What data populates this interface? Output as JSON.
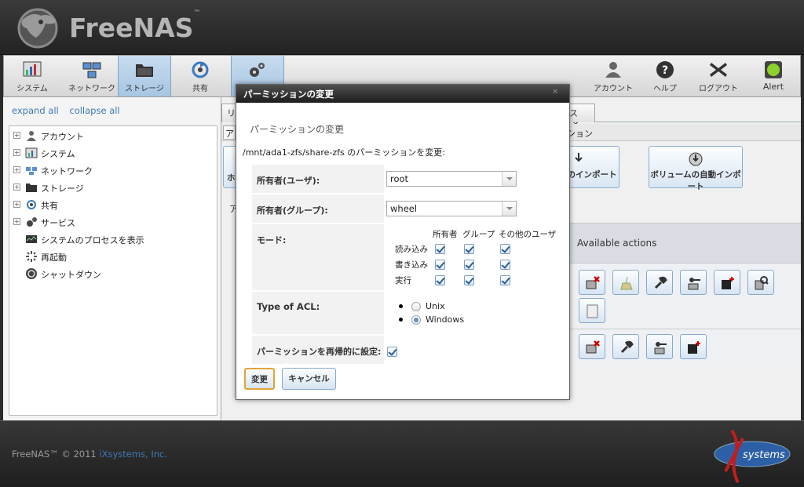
{
  "app": {
    "name": "FreeNAS",
    "tm": "™"
  },
  "toolbar": {
    "items": [
      {
        "label": "システム",
        "icon": "system-icon"
      },
      {
        "label": "ネットワーク",
        "icon": "network-icon"
      },
      {
        "label": "ストレージ",
        "icon": "storage-icon"
      },
      {
        "label": "共有",
        "icon": "sharing-icon"
      },
      {
        "label": "サービス",
        "icon": "services-icon"
      }
    ],
    "right": [
      {
        "label": "アカウント",
        "icon": "account-icon"
      },
      {
        "label": "ヘルプ",
        "icon": "help-icon"
      },
      {
        "label": "ログアウト",
        "icon": "logout-icon"
      },
      {
        "label": "Alert",
        "icon": "alert-icon"
      }
    ]
  },
  "sidebar": {
    "expand_all": "expand all",
    "collapse_all": "collapse all",
    "tree": [
      {
        "label": "アカウント"
      },
      {
        "label": "システム"
      },
      {
        "label": "ネットワーク"
      },
      {
        "label": "ストレージ"
      },
      {
        "label": "共有"
      },
      {
        "label": "サービス"
      }
    ],
    "actions": [
      {
        "label": "システムのプロセスを表示"
      },
      {
        "label": "再起動"
      },
      {
        "label": "シャットダウン"
      }
    ]
  },
  "main": {
    "tab_partial_left": "リ",
    "tab_partial_right": "ス",
    "tab_close": "✕",
    "subtab_left": "ア",
    "subtab_right": "ション",
    "left_btn_partial": "ホ",
    "auto_import_partial": "のインポート",
    "volume_auto_import": "ボリュームの自動インポート",
    "row_letter": "ア",
    "available_actions": "Available actions"
  },
  "modal": {
    "title": "パーミッションの変更",
    "heading": "パーミッションの変更",
    "path_text": "/mnt/ada1-zfs/share-zfs のパーミッションを変更:",
    "owner_user_label": "所有者(ユーザ):",
    "owner_user_value": "root",
    "owner_group_label": "所有者(グループ):",
    "owner_group_value": "wheel",
    "mode_label": "モード:",
    "mode_cols": [
      "所有者",
      "グループ",
      "その他のユーザ"
    ],
    "mode_rows": [
      "読み込み",
      "書き込み",
      "実行"
    ],
    "acl_label": "Type of ACL:",
    "acl_options": [
      "Unix",
      "Windows"
    ],
    "acl_selected": "Windows",
    "recursive_label": "パーミッションを再帰的に設定:",
    "change_button": "変更",
    "cancel_button": "キャンセル"
  },
  "footer": {
    "copyright": "FreeNAS™ © 2011 ",
    "company": "iXsystems, Inc.",
    "logo_text": "systems"
  }
}
